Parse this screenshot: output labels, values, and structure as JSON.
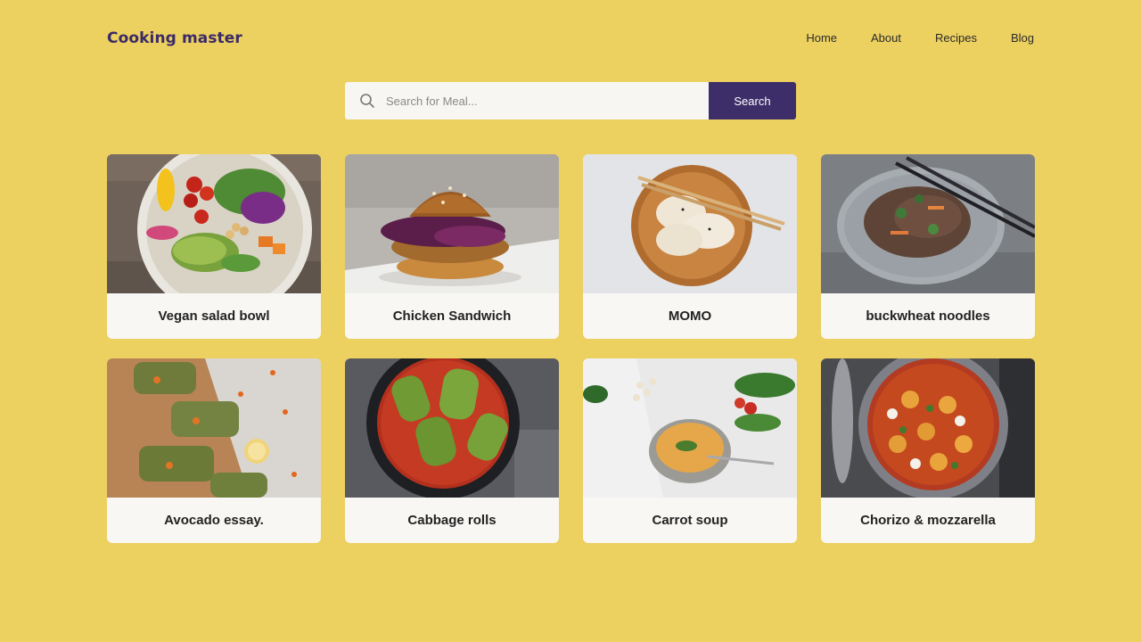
{
  "brand": "Cooking master",
  "nav": [
    "Home",
    "About",
    "Recipes",
    "Blog"
  ],
  "search": {
    "placeholder": "Search for Meal...",
    "button": "Search"
  },
  "recipes": [
    {
      "title": "Vegan salad bowl"
    },
    {
      "title": "Chicken Sandwich"
    },
    {
      "title": "MOMO"
    },
    {
      "title": "buckwheat noodles"
    },
    {
      "title": "Avocado essay."
    },
    {
      "title": "Cabbage rolls"
    },
    {
      "title": "Carrot soup"
    },
    {
      "title": "Chorizo & mozzarella"
    }
  ],
  "colors": {
    "background": "#ecd060",
    "accent": "#3d2e69",
    "card": "#f8f7f4"
  }
}
